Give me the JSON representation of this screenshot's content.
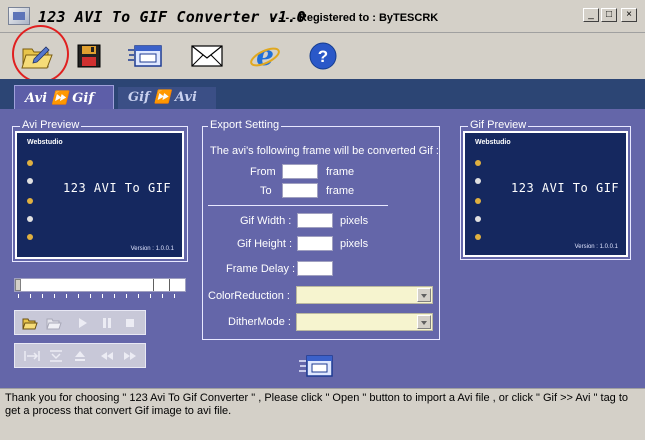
{
  "window": {
    "title": "123 AVI To GIF Converter v1.0",
    "registration": "- - - - Registered to :  ByTESCRK",
    "controls": {
      "minimize": "_",
      "maximize": "□",
      "close": "×"
    }
  },
  "toolbar": {
    "items": [
      {
        "icon": "open-folder-icon",
        "interactable": true
      },
      {
        "icon": "save-disk-icon",
        "interactable": true
      },
      {
        "icon": "convert-window-icon",
        "interactable": true
      },
      {
        "icon": "mail-envelope-icon",
        "interactable": true
      },
      {
        "icon": "internet-explorer-icon",
        "interactable": true
      },
      {
        "icon": "help-question-icon",
        "interactable": true
      }
    ],
    "highlight_color": "#e02020"
  },
  "tabs": [
    {
      "label": "Avi ⏩ Gif",
      "active": true
    },
    {
      "label": "Gif ⏩ Avi",
      "active": false
    }
  ],
  "avi_preview": {
    "label": "Avi Preview",
    "logo": "Webstudio",
    "text": "123 AVI To GIF",
    "version": "Version : 1.0.0.1"
  },
  "gif_preview": {
    "label": "Gif Preview",
    "logo": "Webstudio",
    "text": "123 AVI To GIF",
    "version": "Version : 1.0.0.1"
  },
  "export": {
    "label": "Export  Setting",
    "heading": "The avi's following frame will be converted Gif :",
    "from_label": "From",
    "from_value": "",
    "from_unit": "frame",
    "to_label": "To",
    "to_value": "",
    "to_unit": "frame",
    "gif_width_label": "Gif Width :",
    "gif_width_value": "",
    "gif_width_unit": "pixels",
    "gif_height_label": "Gif Height :",
    "gif_height_value": "",
    "gif_height_unit": "pixels",
    "frame_delay_label": "Frame Delay :",
    "frame_delay_value": "",
    "color_reduction_label": "ColorReduction :",
    "color_reduction_value": "",
    "dither_mode_label": "DitherMode :",
    "dither_mode_value": ""
  },
  "playback": {
    "position": 0,
    "buttons_row1": [
      "open-icon",
      "open-gray-icon",
      "play-icon",
      "pause-icon",
      "stop-icon"
    ],
    "buttons_row2": [
      "mark-in-icon",
      "mark-out-icon",
      "eject-icon",
      "rewind-icon",
      "fast-forward-icon"
    ]
  },
  "status": {
    "text": " Thank you for choosing \" 123 Avi To Gif Converter \" , Please click \" Open \" button  to import a Avi file , or click \" Gif >> Avi \" tag to get a process that convert Gif image to avi file."
  },
  "colors": {
    "panel": "#6466a9",
    "strip": "#2c4574",
    "preview": "#15285f",
    "combo": "#f6f4cf"
  }
}
